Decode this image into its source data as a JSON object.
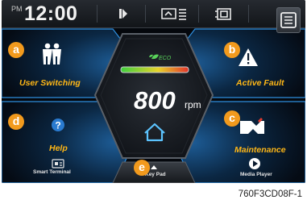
{
  "status_bar": {
    "ampm": "PM",
    "time": "12:00",
    "icons": [
      "left-light-icon",
      "display-list-icon",
      "camera-icon",
      "menu-icon"
    ]
  },
  "tiles": {
    "user_switching": {
      "label": "User Switching",
      "badge": "a",
      "icon": "users-icon"
    },
    "active_fault": {
      "label": "Active Fault",
      "badge": "b",
      "icon": "warning-icon"
    },
    "maintenance": {
      "label": "Maintenance",
      "badge": "c",
      "icon": "maintenance-icon"
    },
    "help": {
      "label": "Help",
      "badge": "d",
      "icon": "help-icon"
    },
    "smart_terminal": {
      "label": "Smart Terminal",
      "icon": "smart-terminal-icon"
    },
    "key_pad": {
      "label": "Key Pad",
      "badge": "e",
      "icon": "chevron-up-icon"
    },
    "media_player": {
      "label": "Media Player",
      "icon": "play-icon"
    }
  },
  "gauge": {
    "eco_label": "ECO",
    "rpm_value": "800",
    "rpm_unit": "rpm",
    "icon": "home-icon"
  },
  "caption": "760F3CD08F-1",
  "colors": {
    "accent_orange": "#f29a1d",
    "label_yellow": "#ffb716",
    "glow_blue": "#2f8fe0",
    "eco_green": "#59d45a"
  }
}
